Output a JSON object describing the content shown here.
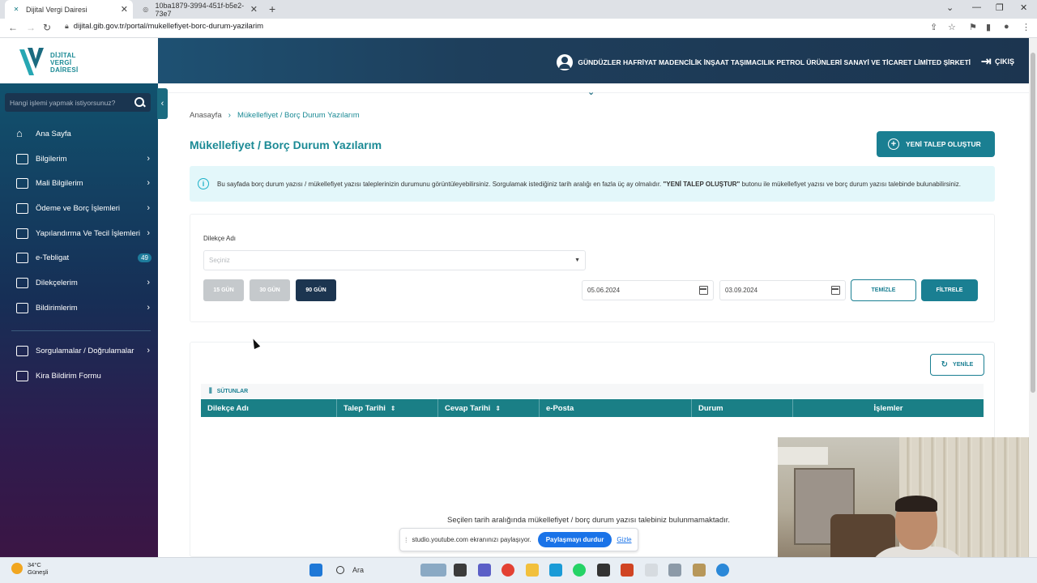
{
  "browser": {
    "tabs": [
      {
        "title": "Dijital Vergi Dairesi",
        "active": true
      },
      {
        "title": "10ba1879-3994-451f-b5e2-73e7",
        "active": false
      }
    ],
    "url": "dijital.gib.gov.tr/portal/mukellefiyet-borc-durum-yazilarim"
  },
  "header": {
    "logo_line1": "DİJİTAL",
    "logo_line2": "VERGİ",
    "logo_line3": "DAİRESİ",
    "user_name": "GÜNDÜZLER HAFRİYAT MADENCİLİK İNŞAAT TAŞIMACILIK PETROL ÜRÜNLERİ SANAYİ VE TİCARET LİMİTED ŞİRKETİ",
    "logout_label": "ÇIKIŞ"
  },
  "sidebar": {
    "search_placeholder": "Hangi işlemi yapmak istiyorsunuz?",
    "items": [
      {
        "label": "Ana Sayfa",
        "icon": "home-icon",
        "chevron": false
      },
      {
        "label": "Bilgilerim",
        "icon": "id-card-icon",
        "chevron": true
      },
      {
        "label": "Mali Bilgilerim",
        "icon": "chart-icon",
        "chevron": true
      },
      {
        "label": "Ödeme ve Borç İşlemleri",
        "icon": "wallet-icon",
        "chevron": true
      },
      {
        "label": "Yapılandırma Ve Tecil İşlemleri",
        "icon": "money-icon",
        "chevron": true
      },
      {
        "label": "e-Tebligat",
        "icon": "mail-icon",
        "chevron": false,
        "badge": "49"
      },
      {
        "label": "Dilekçelerim",
        "icon": "document-icon",
        "chevron": true
      },
      {
        "label": "Bildirimlerim",
        "icon": "bookmark-icon",
        "chevron": true
      },
      {
        "label": "Sorgulamalar / Doğrulamalar",
        "icon": "search-doc-icon",
        "chevron": true
      },
      {
        "label": "Kira Bildirim Formu",
        "icon": "building-icon",
        "chevron": false
      }
    ]
  },
  "main": {
    "breadcrumb_home": "Anasayfa",
    "breadcrumb_current": "Mükellefiyet / Borç Durum Yazılarım",
    "title": "Mükellefiyet / Borç Durum Yazılarım",
    "new_request_label": "YENİ TALEP OLUŞTUR",
    "info_text_part1": "Bu sayfada borç durum yazısı / mükellefiyet yazısı taleplerinizin durumunu görüntüleyebilirsiniz. Sorgulamak istediğiniz tarih aralığı en fazla üç ay olmalıdır.",
    "info_text_bold": "\"YENİ TALEP OLUŞTUR\"",
    "info_text_part2": "butonu ile mükellefiyet yazısı ve borç durum yazısı talebinde bulunabilirsiniz.",
    "filter": {
      "petition_label": "Dilekçe Adı",
      "petition_placeholder": "Seçiniz",
      "range_buttons": [
        {
          "label": "15 GÜN",
          "selected": false
        },
        {
          "label": "30 GÜN",
          "selected": false
        },
        {
          "label": "90 GÜN",
          "selected": true
        }
      ],
      "start_date": "05.06.2024",
      "end_date": "03.09.2024",
      "clear_label": "TEMİZLE",
      "filter_label": "FİLTRELE"
    },
    "table": {
      "refresh_label": "YENİLE",
      "columns_label": "SÜTUNLAR",
      "headers": [
        "Dilekçe Adı",
        "Talep Tarihi",
        "Cevap Tarihi",
        "e-Posta",
        "Durum",
        "İşlemler"
      ],
      "empty_message": "Seçilen tarih aralığında mükellefiyet / borç durum yazısı talebiniz bulunmamaktadır."
    }
  },
  "share_bar": {
    "text": "studio.youtube.com ekranınızı paylaşıyor.",
    "stop_label": "Paylaşmayı durdur",
    "hide_label": "Gizle"
  },
  "taskbar": {
    "weather_temp": "34°C",
    "weather_desc": "Güneşli",
    "search_label": "Ara"
  },
  "colors": {
    "accent": "#1a7f92",
    "table_header": "#1a7f86",
    "selected_range": "#1c3550",
    "info_bg": "#e3f7fa"
  }
}
